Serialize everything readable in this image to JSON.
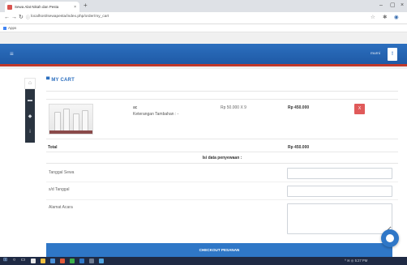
{
  "browser": {
    "tab_title": "Sewa Alat Nikah dan Pesta",
    "tab_close": "×",
    "new_tab": "+",
    "url": "localhost/sewapesta/index.php/order/my_cart",
    "apps_label": "Apps",
    "win_min": "–",
    "win_max": "▢",
    "win_close": "×"
  },
  "header": {
    "menu_icon": "≡",
    "user_name": "murni",
    "user_btn": "!"
  },
  "sidebar": {
    "home_icon": "⌂",
    "cart_icon": "▬",
    "tag_icon": "◆",
    "info_icon": "i"
  },
  "cart": {
    "title": "MY CART",
    "item": {
      "name": "ac",
      "note": "Keterangan Tambahan : -",
      "price_qty": "Rp 50.000 X 9",
      "subtotal": "Rp 450.000",
      "delete_label": "X"
    },
    "total_label": "Total",
    "total_value": "Rp 450.000"
  },
  "form": {
    "heading": "Isi data penyewaan :",
    "tanggal_sewa_label": "Tanggal Sewa",
    "sd_tanggal_label": "s/d Tanggal",
    "alamat_label": "Alamat Acara",
    "tanggal_sewa_value": "",
    "sd_tanggal_value": "",
    "alamat_value": "",
    "checkout_label": "CHECKOUT PESANAN"
  },
  "taskbar": {
    "tray_text": "^ ✉ ◎ 5:27 PM"
  },
  "colors": {
    "header": "#2c6fbf",
    "accent_red": "#c0392b",
    "delete": "#e05a5a",
    "checkout": "#2f77c7"
  }
}
